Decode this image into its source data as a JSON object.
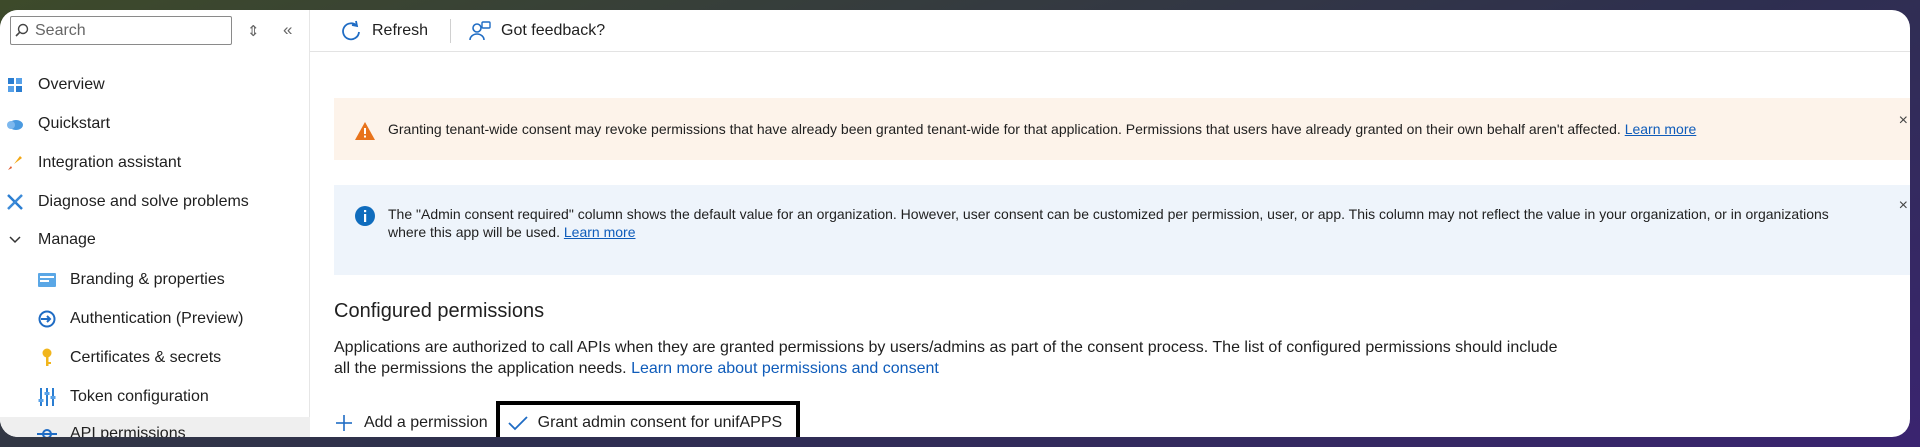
{
  "sidebar": {
    "search_placeholder": "Search",
    "items": [
      {
        "label": "Overview",
        "icon": "overview-grid-icon"
      },
      {
        "label": "Quickstart",
        "icon": "quickstart-cloud-icon"
      },
      {
        "label": "Integration assistant",
        "icon": "rocket-icon"
      },
      {
        "label": "Diagnose and solve problems",
        "icon": "wrench-icon"
      },
      {
        "label": "Manage",
        "icon": "chevron-down-icon"
      },
      {
        "label": "Branding & properties",
        "icon": "branding-card-icon"
      },
      {
        "label": "Authentication (Preview)",
        "icon": "authentication-icon"
      },
      {
        "label": "Certificates & secrets",
        "icon": "key-icon"
      },
      {
        "label": "Token configuration",
        "icon": "token-bars-icon"
      },
      {
        "label": "API permissions",
        "icon": "api-permissions-icon"
      }
    ]
  },
  "toolbar": {
    "refresh_label": "Refresh",
    "feedback_label": "Got feedback?"
  },
  "warning_banner": {
    "text": "Granting tenant-wide consent may revoke permissions that have already been granted tenant-wide for that application. Permissions that users have already granted on their own behalf aren't affected.",
    "link": "Learn more"
  },
  "info_banner": {
    "text": "The \"Admin consent required\" column shows the default value for an organization. However, user consent can be customized per permission, user, or app. This column may not reflect the value in your organization, or in organizations where this app will be used.",
    "link": "Learn more"
  },
  "configured": {
    "title": "Configured permissions",
    "desc_line1": "Applications are authorized to call APIs when they are granted permissions by users/admins as part of the consent process. The list of configured permissions should include",
    "desc_line2": "all the permissions the application needs.",
    "desc_link": "Learn more about permissions and consent"
  },
  "actions": {
    "add_label": "Add a permission",
    "grant_label": "Grant admin consent for unifAPPS"
  },
  "colors": {
    "accent": "#0f5cba",
    "warning": "#e8731c",
    "info": "#0f6cbd"
  }
}
